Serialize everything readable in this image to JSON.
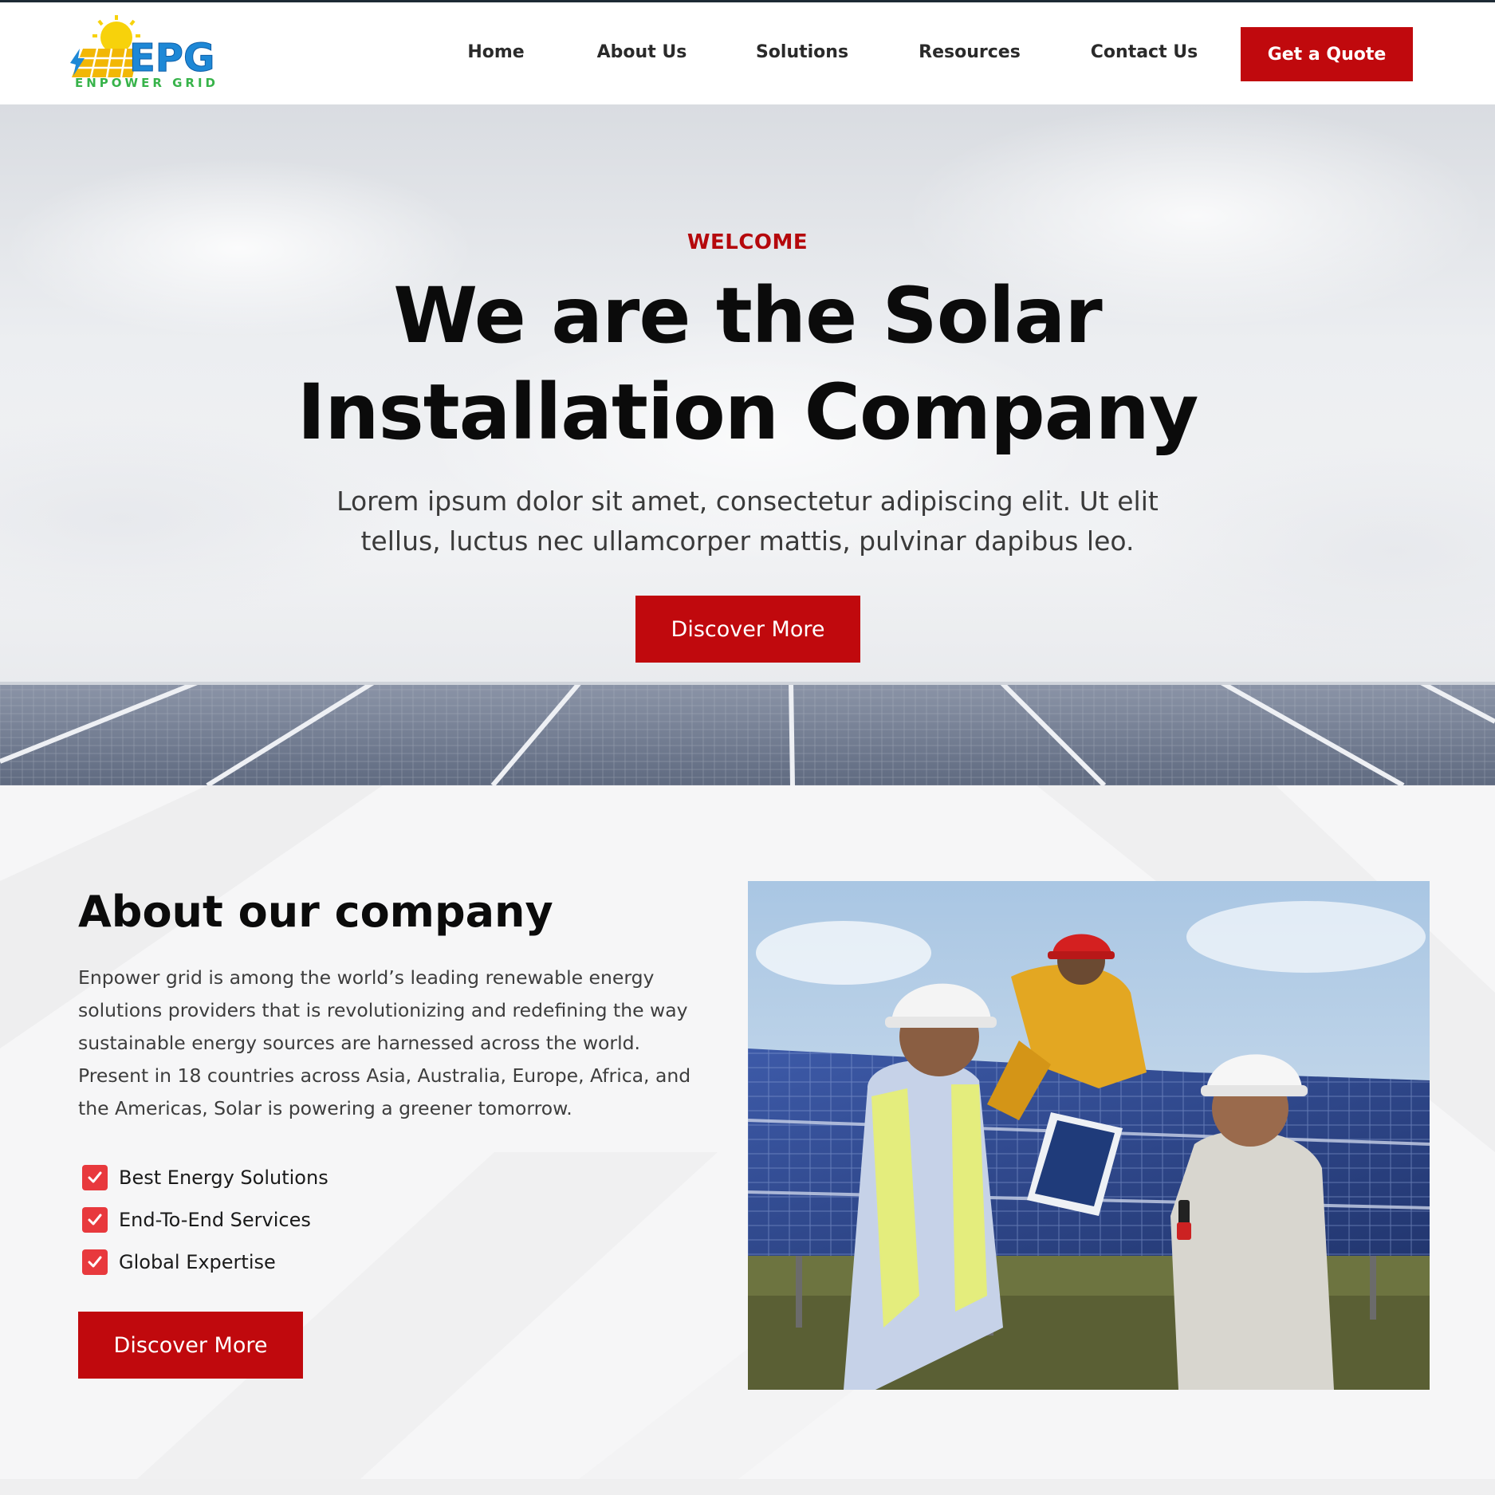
{
  "brand": {
    "logo_letters": "EPG",
    "logo_wordmark": "ENPOWER GRID",
    "colors": {
      "primary_red": "#c0090d",
      "check_red": "#e8393d",
      "logo_blue": "#1e88d6",
      "logo_green": "#37b34a",
      "logo_yellow": "#f7d20b"
    }
  },
  "nav": {
    "items": [
      {
        "label": "Home"
      },
      {
        "label": "About Us"
      },
      {
        "label": "Solutions"
      },
      {
        "label": "Resources"
      },
      {
        "label": "Contact Us"
      }
    ],
    "cta_label": "Get a Quote"
  },
  "hero": {
    "kicker": "WELCOME",
    "title_line1": "We are the Solar",
    "title_line2": "Installation Company",
    "subtitle": "Lorem ipsum dolor sit amet, consectetur adipiscing elit. Ut elit tellus, luctus nec ullamcorper mattis, pulvinar dapibus leo.",
    "button_label": "Discover More"
  },
  "about": {
    "title": "About our company",
    "text": "Enpower grid  is among the world’s leading renewable energy solutions providers that is revolutionizing and redefining the way sustainable energy sources are harnessed across the world. Present in 18 countries across Asia, Australia, Europe, Africa, and the Americas, Solar is powering a greener tomorrow.",
    "features": [
      {
        "label": "Best Energy Solutions",
        "icon": "checkbox-checked-icon"
      },
      {
        "label": "End-To-End Services",
        "icon": "checkbox-checked-icon"
      },
      {
        "label": "Global Expertise",
        "icon": "checkbox-checked-icon"
      }
    ],
    "button_label": "Discover More",
    "photo": "engineers-inspecting-solar-panels"
  }
}
